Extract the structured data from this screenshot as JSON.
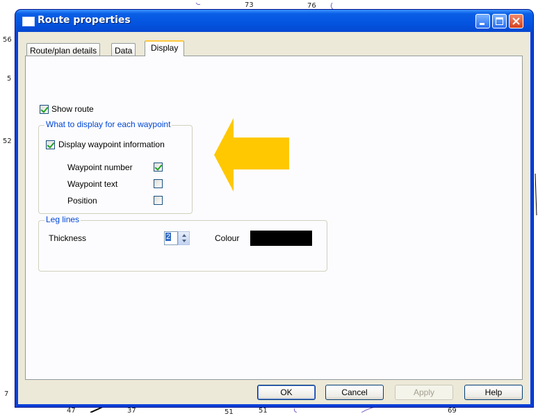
{
  "window": {
    "title": "Route properties"
  },
  "tabs": [
    {
      "label": "Route/plan details",
      "active": false
    },
    {
      "label": "Data",
      "active": false
    },
    {
      "label": "Display",
      "active": true
    }
  ],
  "display": {
    "show_route": {
      "label": "Show route",
      "checked": true
    },
    "waypoint_group": {
      "legend": "What to display for each waypoint",
      "display_info": {
        "label": "Display waypoint information",
        "checked": true
      },
      "options": [
        {
          "label": "Waypoint number",
          "checked": true
        },
        {
          "label": "Waypoint text",
          "checked": false
        },
        {
          "label": "Position",
          "checked": false
        }
      ]
    },
    "leg_lines": {
      "legend": "Leg lines",
      "thickness_label": "Thickness",
      "thickness_value": "2",
      "colour_label": "Colour",
      "colour_value": "#000000"
    }
  },
  "buttons": {
    "ok": "OK",
    "cancel": "Cancel",
    "apply": "Apply",
    "help": "Help"
  },
  "annotation": {
    "arrow_color": "#ffc800"
  },
  "background_chart": {
    "labels": [
      "73",
      "76",
      "56",
      "5",
      "52",
      "7",
      "47",
      "37",
      "51",
      "51",
      "69"
    ]
  }
}
